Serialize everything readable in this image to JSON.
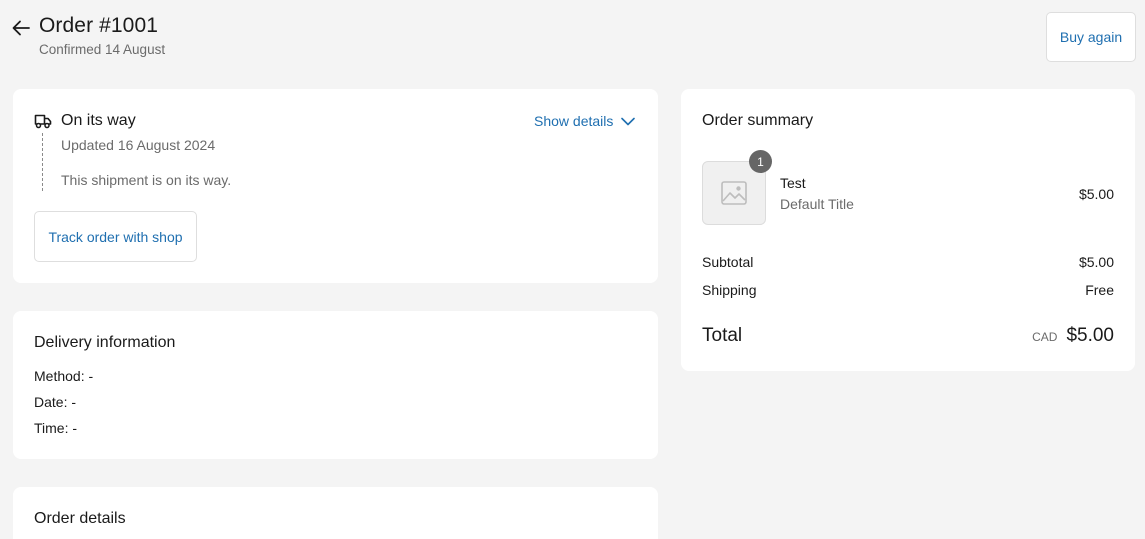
{
  "header": {
    "title": "Order #1001",
    "subtitle": "Confirmed 14 August",
    "buy_again_label": "Buy again",
    "back_icon": "arrow-left-icon"
  },
  "shipment": {
    "status": "On its way",
    "updated": "Updated 16 August 2024",
    "message": "This shipment is on its way.",
    "show_details_label": "Show details",
    "track_button_label": "Track order with shop",
    "status_icon": "truck-icon"
  },
  "delivery": {
    "title": "Delivery information",
    "method": "Method: -",
    "date": "Date: -",
    "time": "Time: -"
  },
  "order_details": {
    "title": "Order details"
  },
  "summary": {
    "title": "Order summary",
    "items": [
      {
        "name": "Test",
        "variant": "Default Title",
        "price": "$5.00",
        "quantity": "1",
        "image_icon": "image-placeholder-icon"
      }
    ],
    "subtotal_label": "Subtotal",
    "subtotal_value": "$5.00",
    "shipping_label": "Shipping",
    "shipping_value": "Free",
    "total_label": "Total",
    "currency": "CAD",
    "total_value": "$5.00"
  },
  "colors": {
    "background": "#f4f4f4",
    "card": "#ffffff",
    "link": "#1f6fb0",
    "muted_text": "#6b6b6b",
    "badge": "#666666"
  }
}
